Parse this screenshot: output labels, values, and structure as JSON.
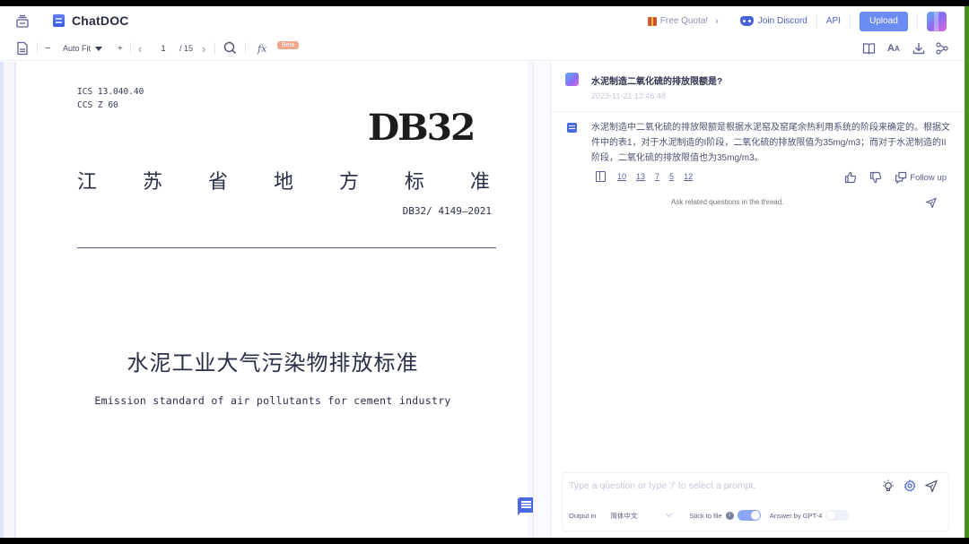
{
  "header": {
    "app_name": "ChatDOC",
    "free_quota": "Free Quota!",
    "free_quota_chevron": "›",
    "join_discord": "Join Discord",
    "api": "API",
    "upload": "Upload"
  },
  "toolbar": {
    "zoom_out": "−",
    "zoom_mode": "Auto Fit",
    "zoom_in": "+",
    "prev_page": "‹",
    "current_page": "1",
    "total_pages": "/ 15",
    "next_page": "›",
    "fx_label": "fx",
    "beta_badge": "Beta"
  },
  "document": {
    "ics": "ICS 13.040.40",
    "ccs": "CCS Z 60",
    "logo_code": "DB32",
    "province_title_chars": [
      "江",
      "苏",
      "省",
      "地",
      "方",
      "标",
      "准"
    ],
    "standard_number": "DB32/ 4149—2021",
    "title_cn": "水泥工业大气污染物排放标准",
    "title_en": "Emission standard of air pollutants for cement industry"
  },
  "chat": {
    "question": "水泥制造二氧化硫的排放限额是?",
    "question_time": "2023-11-21 13:46:48",
    "answer": "水泥制造中二氧化硫的排放限额是根据水泥窑及窑尾余热利用系统的阶段来确定的。根据文件中的表1，对于水泥制造的I阶段，二氧化硫的排放限值为35mg/m3；而对于水泥制造的II阶段，二氧化硫的排放限值也为35mg/m3。",
    "page_refs": [
      "10",
      "13",
      "7",
      "5",
      "12"
    ],
    "follow_up": "Follow up",
    "thread_placeholder": "Ask related questions in the thread."
  },
  "composer": {
    "placeholder": "Type a question or type '/' to select a prompt.",
    "output_in_label": "Output in",
    "output_language": "简体中文",
    "stick_to_file_label": "Stick to file",
    "stick_to_file": true,
    "answer_by_gpt4_label": "Answer by GPT-4",
    "answer_by_gpt4": false,
    "info_glyph": "i"
  }
}
